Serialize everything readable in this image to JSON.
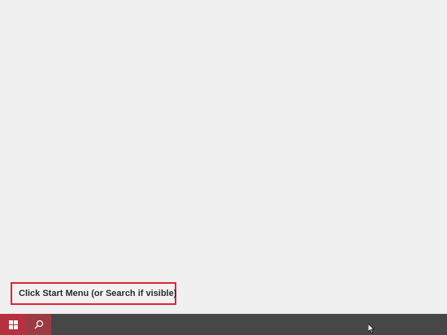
{
  "hint": {
    "label": "Click Start Menu (or Search if visible)"
  },
  "taskbar": {
    "start_icon": "windows-logo-icon",
    "search_icon": "search-icon"
  },
  "colors": {
    "desktop_bg": "#f0f0f0",
    "taskbar_bg": "#474747",
    "start_bg": "#b6313f",
    "search_bg": "#9b3b44",
    "hint_border": "#e0243a"
  }
}
